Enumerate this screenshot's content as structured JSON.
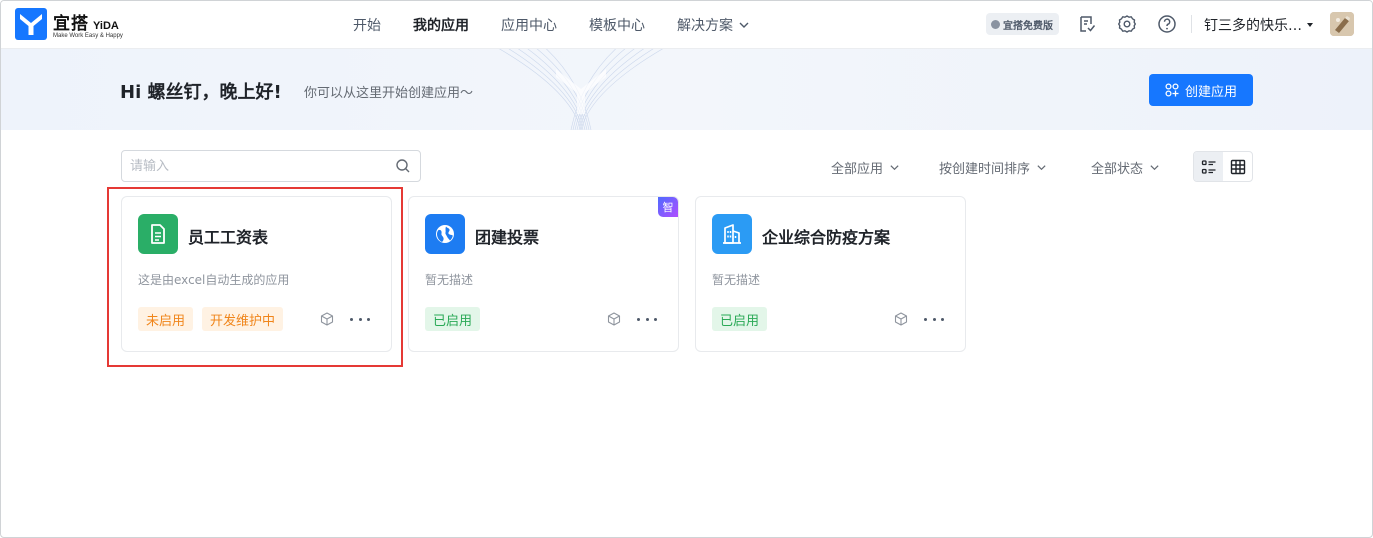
{
  "brand": {
    "name": "宜搭",
    "name_en": "YiDA",
    "slogan": "Make Work Easy & Happy"
  },
  "nav": {
    "items": [
      {
        "label": "开始",
        "active": false
      },
      {
        "label": "我的应用",
        "active": true
      },
      {
        "label": "应用中心",
        "active": false
      },
      {
        "label": "模板中心",
        "active": false
      },
      {
        "label": "解决方案",
        "active": false
      }
    ]
  },
  "header": {
    "free_badge": "宜搭免费版",
    "user_name": "钉三多的快乐…"
  },
  "banner": {
    "greeting": "Hi 螺丝钉，晚上好!",
    "subtitle": "你可以从这里开始创建应用～",
    "create_button": "创建应用"
  },
  "toolbar": {
    "search_placeholder": "请输入",
    "filter_apps": "全部应用",
    "sort": "按创建时间排序",
    "filter_status": "全部状态"
  },
  "apps": [
    {
      "title": "员工工资表",
      "description": "这是由excel自动生成的应用",
      "tags": [
        "未启用",
        "开发维护中"
      ],
      "icon": "document-icon",
      "color": "#2aae67"
    },
    {
      "title": "团建投票",
      "description": "暂无描述",
      "tags": [
        "已启用"
      ],
      "icon": "globe-icon",
      "color": "#1d7cf2",
      "ai_badge": "智"
    },
    {
      "title": "企业综合防疫方案",
      "description": "暂无描述",
      "tags": [
        "已启用"
      ],
      "icon": "building-icon",
      "color": "#2b9bf4"
    }
  ],
  "colors": {
    "primary": "#1677ff",
    "highlight": "#e53935"
  }
}
